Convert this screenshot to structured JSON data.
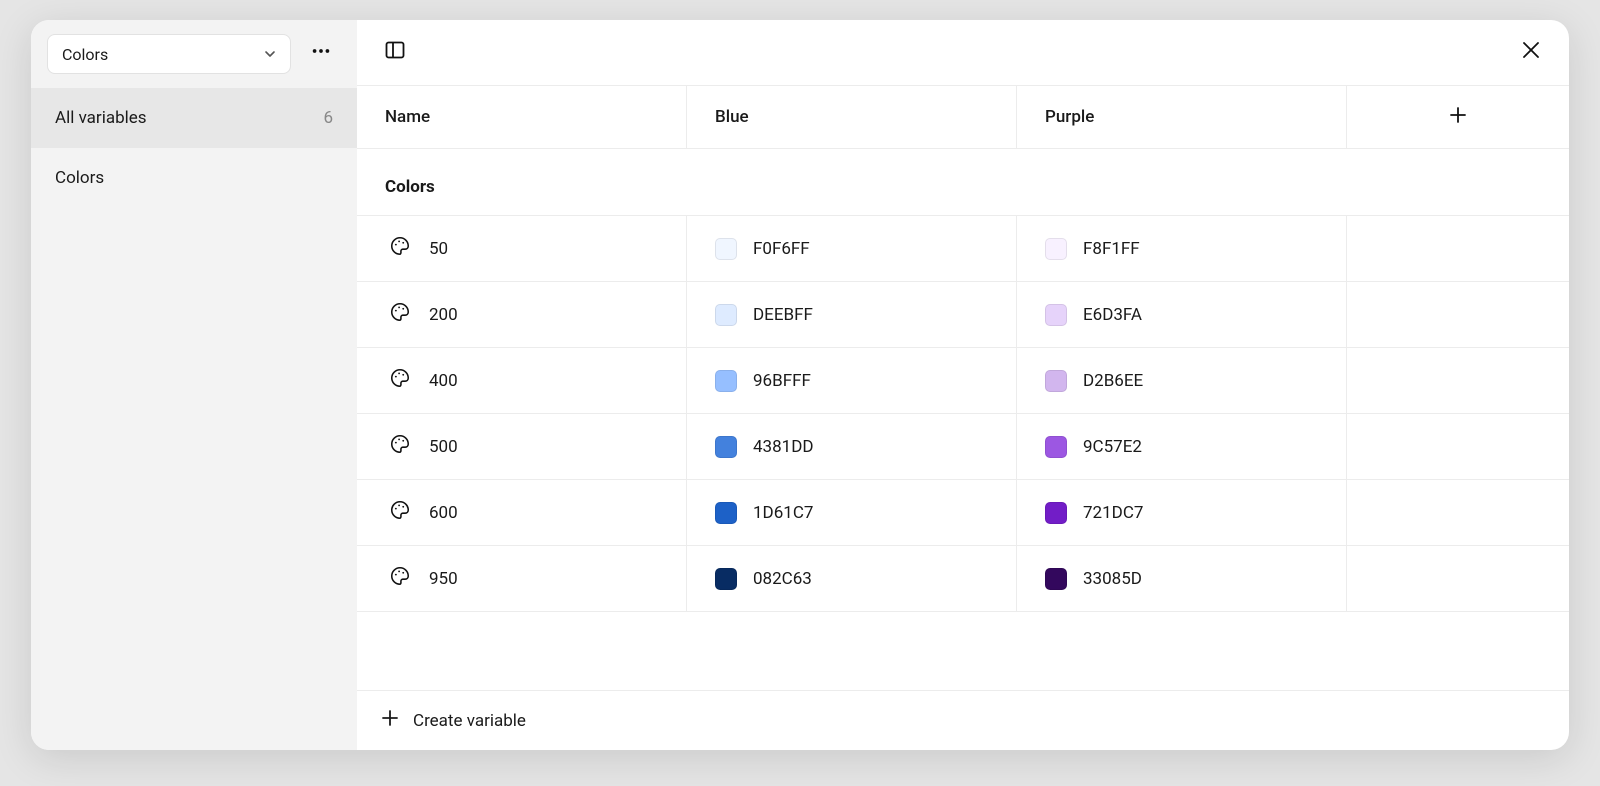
{
  "sidebar": {
    "collection_label": "Colors",
    "all_variables_label": "All variables",
    "variable_count": "6",
    "groups": [
      {
        "label": "Colors"
      }
    ]
  },
  "columns": {
    "name": "Name",
    "modes": [
      "Blue",
      "Purple"
    ]
  },
  "group_title": "Colors",
  "variables": [
    {
      "name": "50",
      "values": [
        {
          "hex": "F0F6FF"
        },
        {
          "hex": "F8F1FF"
        }
      ]
    },
    {
      "name": "200",
      "values": [
        {
          "hex": "DEEBFF"
        },
        {
          "hex": "E6D3FA"
        }
      ]
    },
    {
      "name": "400",
      "values": [
        {
          "hex": "96BFFF"
        },
        {
          "hex": "D2B6EE"
        }
      ]
    },
    {
      "name": "500",
      "values": [
        {
          "hex": "4381DD"
        },
        {
          "hex": "9C57E2"
        }
      ]
    },
    {
      "name": "600",
      "values": [
        {
          "hex": "1D61C7"
        },
        {
          "hex": "721DC7"
        }
      ]
    },
    {
      "name": "950",
      "values": [
        {
          "hex": "082C63"
        },
        {
          "hex": "33085D"
        }
      ]
    }
  ],
  "footer": {
    "create_label": "Create variable"
  }
}
